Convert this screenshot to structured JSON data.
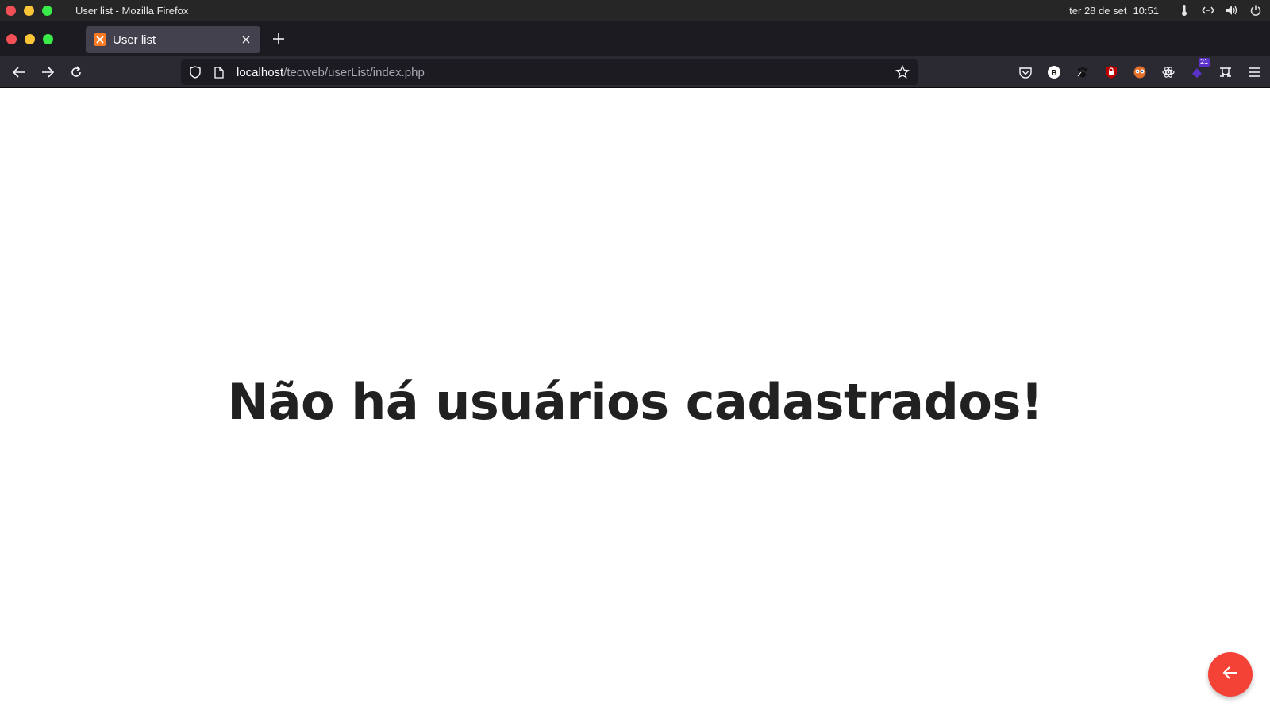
{
  "system": {
    "window_title": "User list - Mozilla Firefox",
    "date": "ter 28 de set",
    "time": "10:51"
  },
  "browser": {
    "tab_title": "User list",
    "url_host": "localhost",
    "url_path": "/tecweb/userList/index.php",
    "extension_badge": "21"
  },
  "page": {
    "empty_message": "Não há usuários cadastrados!"
  },
  "colors": {
    "fab": "#f44336",
    "text": "#212121"
  },
  "icons": {
    "back_nav": "arrow-left-icon",
    "forward_nav": "arrow-right-icon",
    "reload": "reload-icon",
    "bookmark": "star-icon",
    "fab": "arrow-left-icon"
  }
}
